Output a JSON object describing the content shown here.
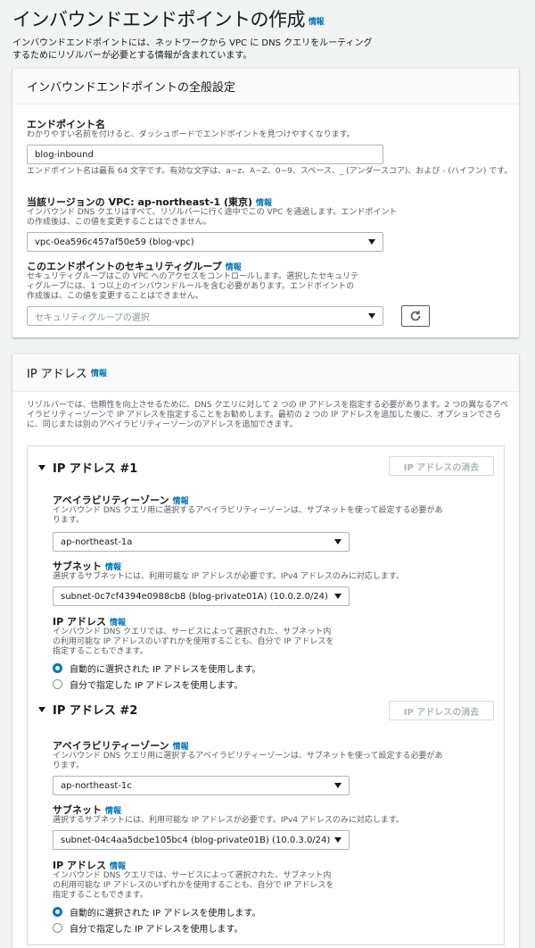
{
  "page": {
    "title": "インバウンドエンドポイントの作成",
    "title_info": "情報",
    "description": "インバウンドエンドポイントには、ネットワークから VPC に DNS クエリをルーティングするためにリゾルバーが必要とする情報が含まれています。"
  },
  "general": {
    "header": "インバウンドエンドポイントの全般設定",
    "endpoint_name": {
      "label": "エンドポイント名",
      "description": "わかりやすい名前を付けると、ダッシュボードでエンドポイントを見つけやすくなります。",
      "value": "blog-inbound",
      "constraint": "エンドポイント名は最長 64 文字です。有効な文字は、a~z、A~Z、0~9、スペース、_ (アンダースコア)、および - (ハイフン) です。"
    },
    "vpc": {
      "label": "当該リージョンの VPC: ap-northeast-1 (東京)",
      "info": "情報",
      "description": "インバウンド DNS クエリはすべて、リゾルバーに行く途中でこの VPC を通過します。エンドポイントの作成後は、この値を変更することはできません。",
      "value": "vpc-0ea596c457af50e59 (blog-vpc)"
    },
    "security_group": {
      "label": "このエンドポイントのセキュリティグループ",
      "info": "情報",
      "description": "セキュリティグループはこの VPC へのアクセスをコントロールします。選択したセキュリティグループには、1 つ以上のインバウンドルールを含む必要があります。エンドポイントの作成後は、この値を変更することはできません。",
      "placeholder": "セキュリティグループの選択"
    }
  },
  "ip_section": {
    "header": "IP アドレス",
    "info": "情報",
    "description": "リゾルバーでは、信頼性を向上させるために、DNS クエリに対して 2 つの IP アドレスを指定する必要があります。2 つの異なるアベイラビリティーゾーンで IP アドレスを指定することをお勧めします。最初の 2 つの IP アドレスを追加した後に、オプションでさらに、同じまたは別のアベイラビリティーゾーンのアドレスを追加できます。",
    "addresses": [
      {
        "title": "IP アドレス #1",
        "remove_label": "IP アドレスの消去",
        "az_label": "アベイラビリティーゾーン",
        "az_info": "情報",
        "az_description": "インバウンド DNS クエリ用に選択するアベイラビリティーゾーンは、サブネットを使って設定する必要があります。",
        "az_value": "ap-northeast-1a",
        "subnet_label": "サブネット",
        "subnet_info": "情報",
        "subnet_description": "選択するサブネットには、利用可能な IP アドレスが必要です。IPv4 アドレスのみに対応します。",
        "subnet_value": "subnet-0c7cf4394e0988cb8 (blog-private01A) (10.0.2.0/24)",
        "ip_label": "IP アドレス",
        "ip_info": "情報",
        "ip_description": "インバウンド DNS クエリでは、サービスによって選択された、サブネット内の利用可能な IP アドレスのいずれかを使用することも、自分で IP アドレスを指定することもできます。",
        "option_auto": "自動的に選択された IP アドレスを使用します。",
        "option_manual": "自分で指定した IP アドレスを使用します。"
      },
      {
        "title": "IP アドレス #2",
        "remove_label": "IP アドレスの消去",
        "az_label": "アベイラビリティーゾーン",
        "az_info": "情報",
        "az_description": "インバウンド DNS クエリ用に選択するアベイラビリティーゾーンは、サブネットを使って設定する必要があります。",
        "az_value": "ap-northeast-1c",
        "subnet_label": "サブネット",
        "subnet_info": "情報",
        "subnet_description": "選択するサブネットには、利用可能な IP アドレスが必要です。IPv4 アドレスのみに対応します。",
        "subnet_value": "subnet-04c4aa5dcbe105bc4 (blog-private01B) (10.0.3.0/24)",
        "ip_label": "IP アドレス",
        "ip_info": "情報",
        "ip_description": "インバウンド DNS クエリでは、サービスによって選択された、サブネット内の利用可能な IP アドレスのいずれかを使用することも、自分で IP アドレスを指定することもできます。",
        "option_auto": "自動的に選択された IP アドレスを使用します。",
        "option_manual": "自分で指定した IP アドレスを使用します。"
      }
    ]
  },
  "colors": {
    "link": "#0073bb",
    "page_bg": "#f2f3f3",
    "disabled": "#aab7b8"
  }
}
